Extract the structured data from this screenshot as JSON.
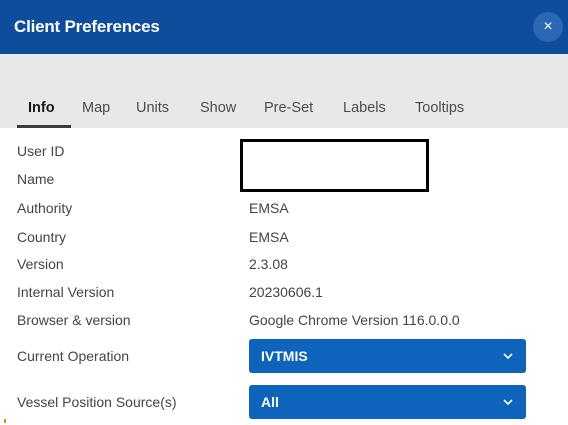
{
  "dialog": {
    "title": "Client Preferences",
    "close_symbol": "×"
  },
  "tabs": [
    {
      "label": "Info",
      "active": true
    },
    {
      "label": "Map",
      "active": false
    },
    {
      "label": "Units",
      "active": false
    },
    {
      "label": "Show",
      "active": false
    },
    {
      "label": "Pre-Set",
      "active": false
    },
    {
      "label": "Labels",
      "active": false
    },
    {
      "label": "Tooltips",
      "active": false
    }
  ],
  "info": {
    "user_id_label": "User ID",
    "name_label": "Name",
    "authority_label": "Authority",
    "authority_value": "EMSA",
    "country_label": "Country",
    "country_value": "EMSA",
    "version_label": "Version",
    "version_value": "2.3.08",
    "internal_version_label": "Internal Version",
    "internal_version_value": "20230606.1",
    "browser_label": "Browser & version",
    "browser_value": "Google Chrome Version 116.0.0.0",
    "current_operation_label": "Current Operation",
    "current_operation_value": "IVTMIS",
    "vessel_source_label": "Vessel Position Source(s)",
    "vessel_source_value": "All"
  },
  "colors": {
    "title_bar": "#0d4d9c",
    "select_bg": "#0d64ba",
    "tab_bar": "#e8e8e8"
  }
}
